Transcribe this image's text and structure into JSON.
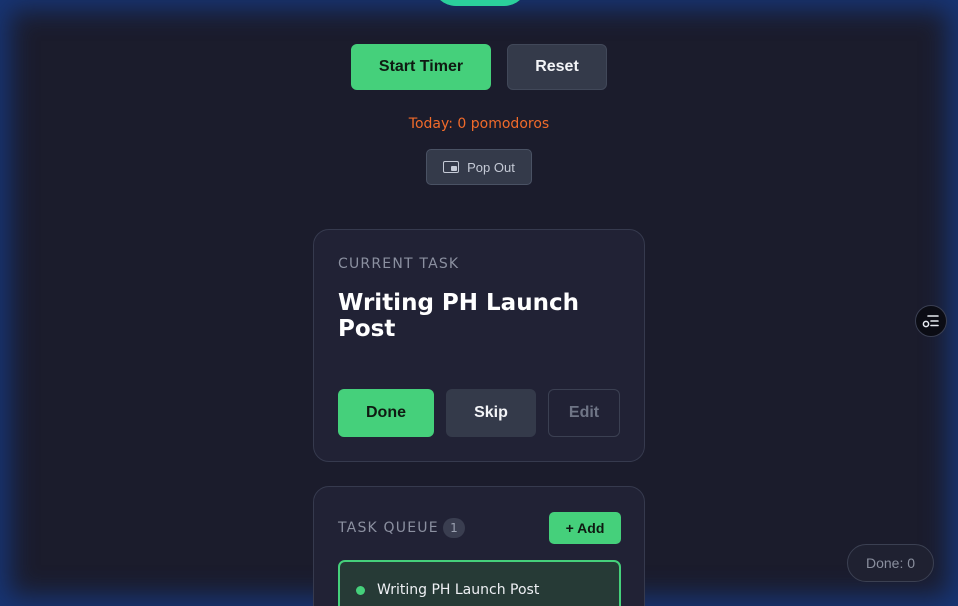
{
  "timer": {
    "start_label": "Start Timer",
    "reset_label": "Reset",
    "today_text": "Today: 0 pomodoros",
    "popout_label": "Pop Out"
  },
  "current_task": {
    "section_label": "CURRENT TASK",
    "title": "Writing PH Launch Post",
    "done_label": "Done",
    "skip_label": "Skip",
    "edit_label": "Edit"
  },
  "task_queue": {
    "section_label": "TASK QUEUE",
    "count": "1",
    "add_label": "+ Add",
    "items": [
      {
        "label": "Writing PH Launch Post"
      }
    ]
  },
  "footer": {
    "done_counter": "Done: 0"
  },
  "icons": {
    "popout": "picture-in-picture-icon",
    "side_panel": "task-list-toggle-icon"
  },
  "colors": {
    "accent_green": "#45d07b",
    "today_orange": "#f06a2a",
    "background": "#1b1c2c",
    "card": "#212235"
  }
}
